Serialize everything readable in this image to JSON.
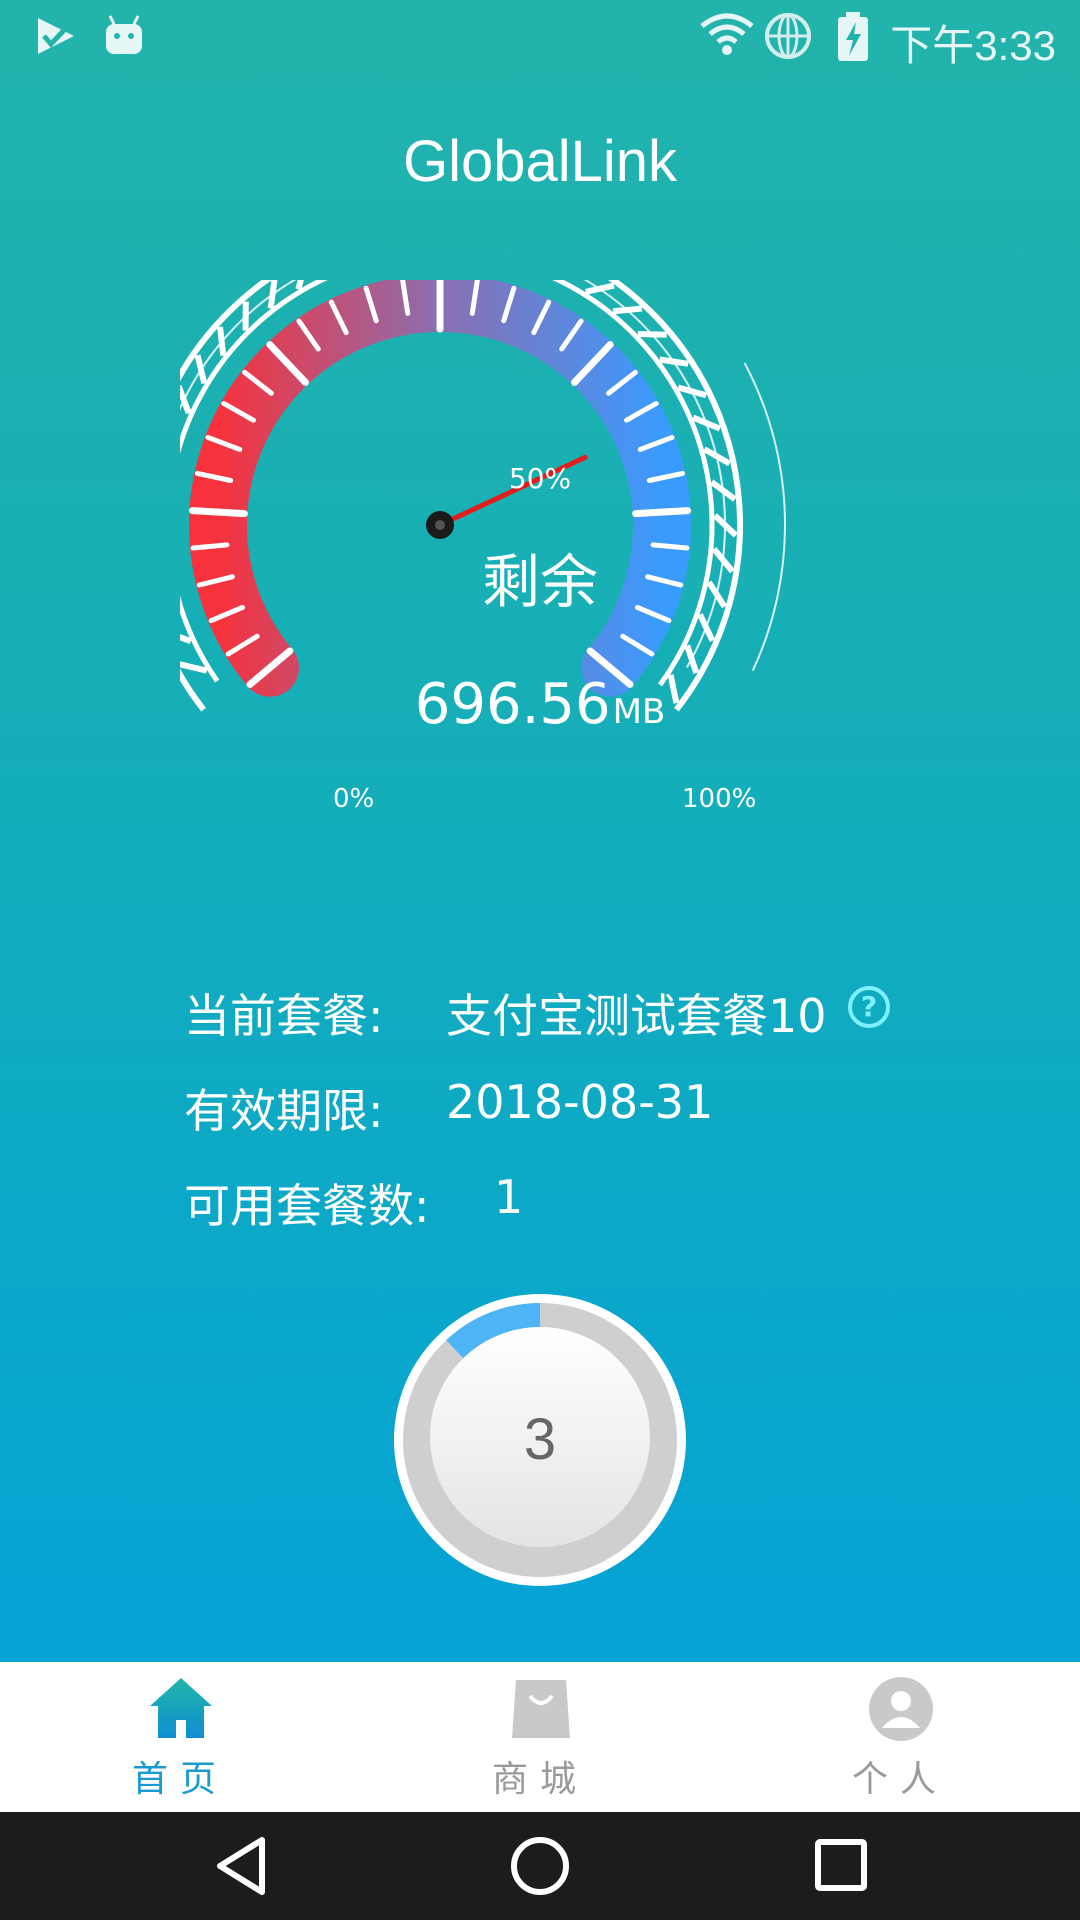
{
  "status_bar": {
    "time": "下午3:33",
    "icons": [
      "check-flag-icon",
      "android-icon",
      "wifi-icon",
      "globe-icon",
      "battery-charging-icon"
    ]
  },
  "app": {
    "title": "GlobalLink"
  },
  "gauge": {
    "center_label": "剩余",
    "value": "696.56",
    "unit": "MB",
    "label_min": "0%",
    "label_mid": "50%",
    "label_max": "100%",
    "needle_percent": 75,
    "colors": {
      "low": "#f7323c",
      "mid": "#8a6fb0",
      "high": "#3a9bff",
      "needle": "#e31c1c"
    }
  },
  "plan": {
    "current_label": "当前套餐:",
    "current_value": "支付宝测试套餐10",
    "expiry_label": "有效期限:",
    "expiry_value": "2018-08-31",
    "count_label": "可用套餐数:",
    "count_value": "1"
  },
  "timer": {
    "value": "3",
    "progress_percent": 12,
    "accent": "#4db4f5"
  },
  "tabs": [
    {
      "label": "首页",
      "icon": "home-icon",
      "active": true
    },
    {
      "label": "商城",
      "icon": "shopping-bag-icon",
      "active": false
    },
    {
      "label": "个人",
      "icon": "user-icon",
      "active": false
    }
  ],
  "colors": {
    "active_tab": "#1a9ad0",
    "inactive_tab": "#9a9a9a"
  },
  "nav": [
    "back-icon",
    "home-circle-icon",
    "recents-icon"
  ]
}
